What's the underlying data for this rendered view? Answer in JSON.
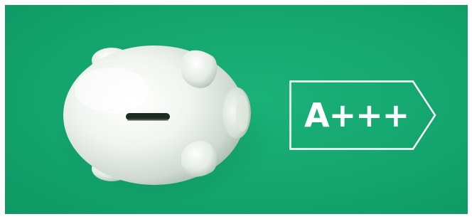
{
  "energy_label": {
    "rating": "A+++"
  },
  "colors": {
    "background": "#14a56e",
    "label_stroke": "#ffffff",
    "label_text": "#ffffff",
    "piggy_body": "#f2f6f1"
  },
  "objects": {
    "piggy_bank": "piggy-bank",
    "coin_slot": "coin-slot"
  }
}
